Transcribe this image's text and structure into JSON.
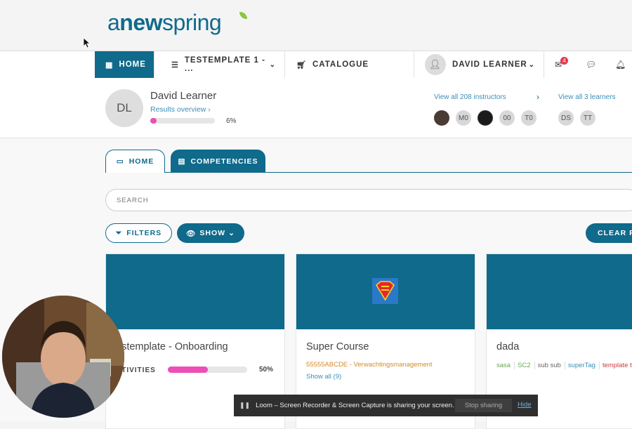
{
  "brand": {
    "logo_a": "a",
    "logo_new": "new",
    "logo_spring": "spring"
  },
  "nav": {
    "home": "HOME",
    "template": "TESTEMPLATE 1 - ...",
    "catalogue": "CATALOGUE",
    "user": "DAVID LEARNER",
    "messages_badge": "4"
  },
  "profile": {
    "initials": "DL",
    "name": "David Learner",
    "results_link": "Results overview",
    "progress_label": "6%",
    "progress_value": 0.06,
    "instructors_link": "View all 208 instructors",
    "learners_link": "View all 3 learners",
    "instructor_chips": [
      "M0",
      "00",
      "T0"
    ],
    "learner_chips": [
      "DS",
      "TT"
    ]
  },
  "tabs": {
    "home": "HOME",
    "competencies": "COMPETENCIES"
  },
  "search": {
    "placeholder": "SEARCH"
  },
  "toolbar": {
    "filters": "FILTERS",
    "show": "SHOW",
    "clear": "CLEAR FI"
  },
  "cards": [
    {
      "title": "estemplate - Onboarding",
      "activities_label": "CTIVITIES",
      "progress_label": "50%",
      "progress_value": 0.5
    },
    {
      "title": "Super Course",
      "subtitle": "55555ABCDE - Verwachtingsmanagement",
      "show_all": "Show all (9)"
    },
    {
      "title": "dada",
      "tags": [
        "sasa",
        "SC2",
        "sub sub",
        "superTag",
        "template ty"
      ]
    }
  ],
  "loom": {
    "message": "Loom – Screen Recorder & Screen Capture is sharing your screen.",
    "stop": "Stop sharing",
    "hide": "Hide"
  },
  "colors": {
    "primary": "#0f6a8b",
    "progress": "#ec4fb6",
    "tag_green": "#6aa84f",
    "tag_blue": "#3a8fb7",
    "tag_red": "#cc3b3b"
  }
}
